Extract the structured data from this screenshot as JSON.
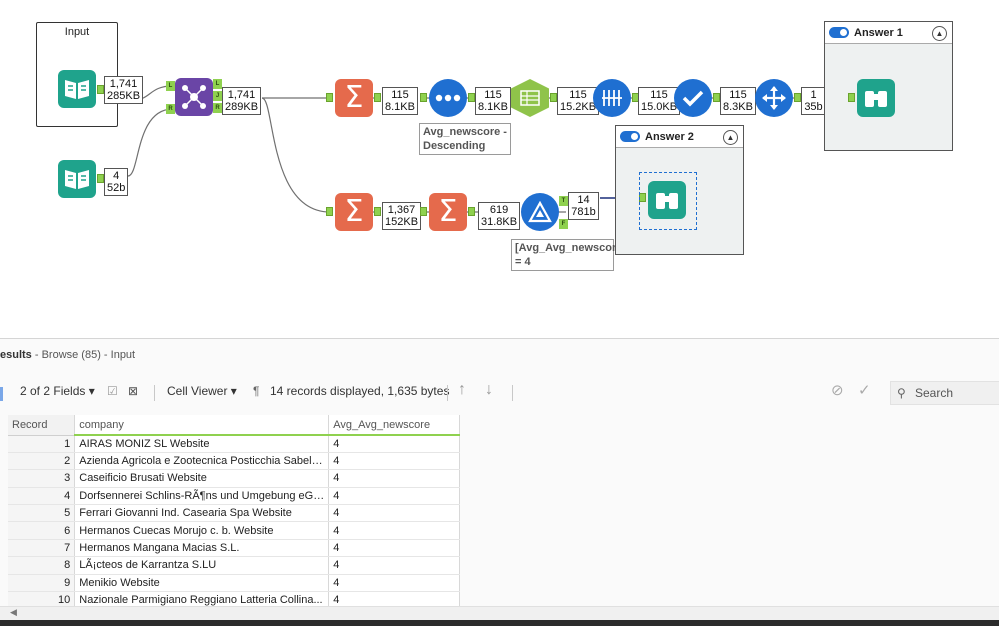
{
  "canvas": {
    "input_container_title": "Input",
    "answer1": {
      "title": "Answer 1"
    },
    "answer2": {
      "title": "Answer 2"
    },
    "counts": {
      "input1": [
        "1,741",
        "285KB"
      ],
      "input2": [
        "4",
        "52b"
      ],
      "join": [
        "1,741",
        "289KB"
      ],
      "summ1": [
        "115",
        "8.1KB"
      ],
      "sort": [
        "115",
        "8.1KB"
      ],
      "cube": [
        "115",
        "15.2KB"
      ],
      "table": [
        "115",
        "15.0KB"
      ],
      "check": [
        "115",
        "8.3KB"
      ],
      "arrange": [
        "1",
        "35b"
      ],
      "summ2": [
        "1,367",
        "152KB"
      ],
      "summ3": [
        "619",
        "31.8KB"
      ],
      "filter": [
        "14",
        "781b"
      ]
    },
    "annotations": {
      "sort": "Avg_newscore - Descending",
      "filter": "[Avg_Avg_newscore] = 4"
    },
    "anchor_labels": {
      "join_left": "L",
      "join_right": "R",
      "join_out_l": "L",
      "join_out_j": "J",
      "join_out_r": "R",
      "filter_true": "T",
      "filter_false": "F"
    },
    "colors": {
      "input": "#1fa38c",
      "summarize": "#e56a4c",
      "sort": "#1f6fd1",
      "cube": "#8fc34a",
      "join": "#6a45a6",
      "anchor": "#8fd14f"
    }
  },
  "results": {
    "title_bold": "esults",
    "title_rest": " - Browse (85) - Input",
    "toolbar": {
      "fields": "2 of 2 Fields",
      "viewer": "Cell Viewer",
      "pilcrow": "¶",
      "records": "14 records displayed, 1,635 bytes",
      "search": "Search"
    },
    "columns": [
      "Record",
      "company",
      "Avg_Avg_newscore"
    ],
    "rows": [
      [
        "1",
        "AIRAS MONIZ SL  Website",
        "4"
      ],
      [
        "2",
        "Azienda Agricola e Zootecnica Posticchia Sabelli...",
        "4"
      ],
      [
        "3",
        "Caseificio Brusati  Website",
        "4"
      ],
      [
        "4",
        "Dorfsennerei Schlins-RÃ¶ns und Umgebung eGe...",
        "4"
      ],
      [
        "5",
        "Ferrari Giovanni Ind. Casearia Spa  Website",
        "4"
      ],
      [
        "6",
        "Hermanos Cuecas Morujo c. b.  Website",
        "4"
      ],
      [
        "7",
        "Hermanos Mangana Macias S.L.",
        "4"
      ],
      [
        "8",
        "LÃ¡cteos de Karrantza S.LU",
        "4"
      ],
      [
        "9",
        "Menikio  Website",
        "4"
      ],
      [
        "10",
        "Nazionale Parmigiano Reggiano Latteria Collina...",
        "4"
      ]
    ]
  }
}
